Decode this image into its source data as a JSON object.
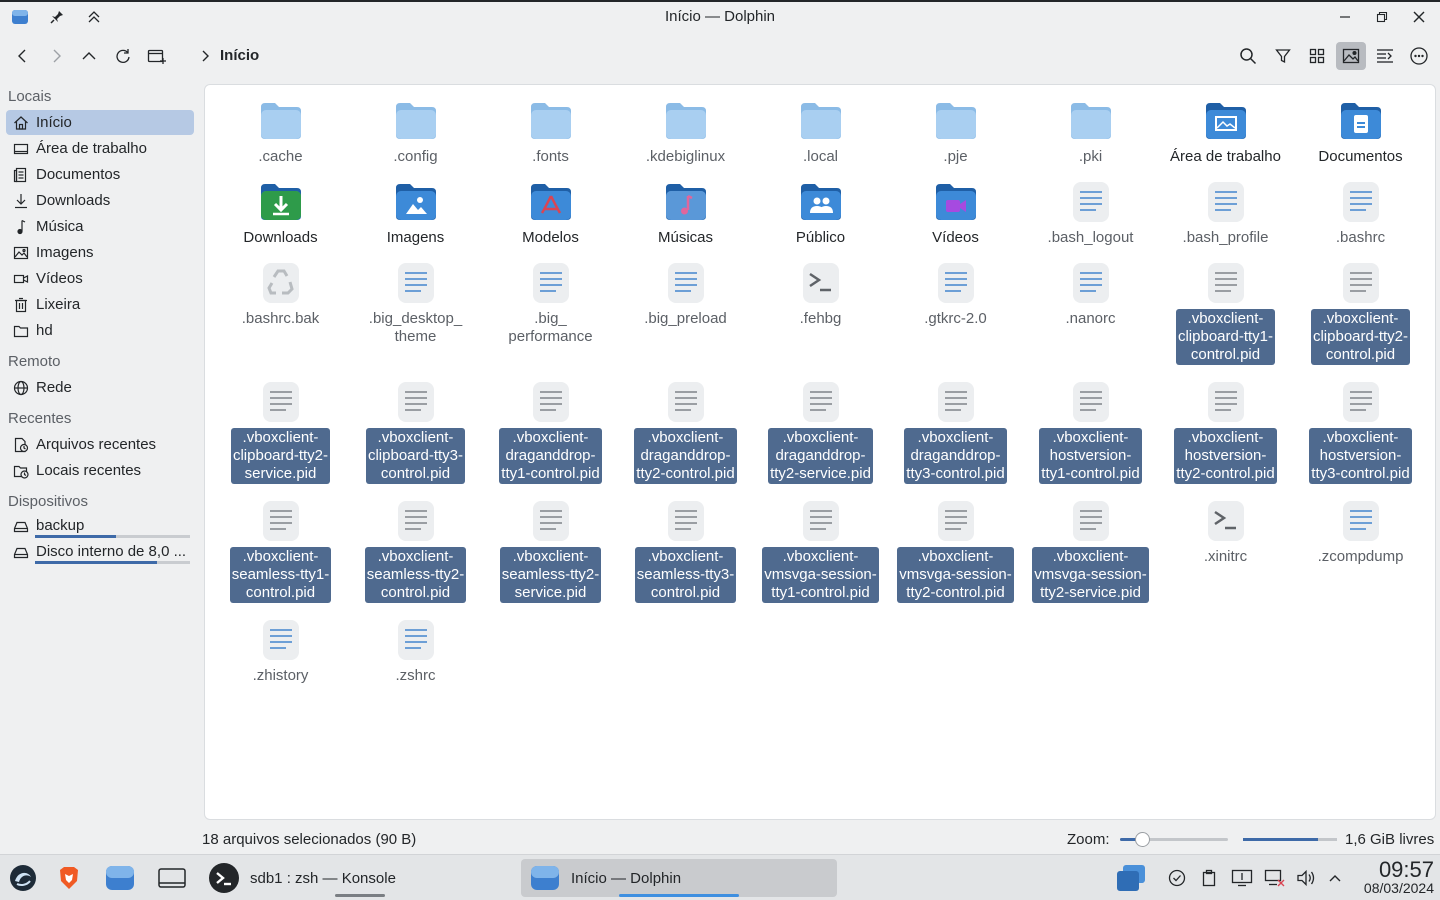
{
  "window": {
    "title": "Início — Dolphin"
  },
  "breadcrumb": {
    "current": "Início"
  },
  "sidebar": {
    "sections": [
      "Locais",
      "Remoto",
      "Recentes",
      "Dispositivos"
    ],
    "places": [
      "Início",
      "Área de trabalho",
      "Documentos",
      "Downloads",
      "Música",
      "Imagens",
      "Vídeos",
      "Lixeira",
      "hd"
    ],
    "remote": [
      "Rede"
    ],
    "recent": [
      "Arquivos recentes",
      "Locais recentes"
    ],
    "devices": [
      {
        "label": "backup",
        "usage": 0.52
      },
      {
        "label": "Disco interno de 8,0 ...",
        "usage": 0.79
      }
    ]
  },
  "files": [
    {
      "name": ".cache",
      "icon": "folder-icon",
      "selected": false
    },
    {
      "name": ".config",
      "icon": "folder-icon",
      "selected": false
    },
    {
      "name": ".fonts",
      "icon": "folder-icon",
      "selected": false
    },
    {
      "name": ".kdebiglinux",
      "icon": "folder-icon",
      "selected": false
    },
    {
      "name": ".local",
      "icon": "folder-icon",
      "selected": false
    },
    {
      "name": ".pje",
      "icon": "folder-icon",
      "selected": false
    },
    {
      "name": ".pki",
      "icon": "folder-icon",
      "selected": false
    },
    {
      "name": "Área de trabalho",
      "icon": "folder-desktop-icon",
      "selected": false
    },
    {
      "name": "Documentos",
      "icon": "folder-documents-icon",
      "selected": false
    },
    {
      "name": "Downloads",
      "icon": "folder-download-icon",
      "selected": false
    },
    {
      "name": "Imagens",
      "icon": "folder-pictures-icon",
      "selected": false
    },
    {
      "name": "Modelos",
      "icon": "folder-templates-icon",
      "selected": false
    },
    {
      "name": "Músicas",
      "icon": "folder-music-icon",
      "selected": false
    },
    {
      "name": "Público",
      "icon": "folder-public-icon",
      "selected": false
    },
    {
      "name": "Vídeos",
      "icon": "folder-videos-icon",
      "selected": false
    },
    {
      "name": ".bash_logout",
      "icon": "text-file-icon",
      "selected": false
    },
    {
      "name": ".bash_profile",
      "icon": "text-file-icon",
      "selected": false
    },
    {
      "name": ".bashrc",
      "icon": "text-file-icon",
      "selected": false
    },
    {
      "name": ".bashrc.bak",
      "icon": "backup-file-icon",
      "selected": false
    },
    {
      "name": ".big_desktop_\ntheme",
      "icon": "text-file-icon",
      "selected": false
    },
    {
      "name": ".big_\nperformance",
      "icon": "text-file-icon",
      "selected": false
    },
    {
      "name": ".big_preload",
      "icon": "text-file-icon",
      "selected": false
    },
    {
      "name": ".fehbg",
      "icon": "script-file-icon",
      "selected": false
    },
    {
      "name": ".gtkrc-2.0",
      "icon": "text-file-icon",
      "selected": false
    },
    {
      "name": ".nanorc",
      "icon": "text-file-icon",
      "selected": false
    },
    {
      "name": ".vboxclient-\nclipboard-tty1-\ncontrol.pid",
      "icon": "plain-file-icon",
      "selected": true
    },
    {
      "name": ".vboxclient-\nclipboard-tty2-\ncontrol.pid",
      "icon": "plain-file-icon",
      "selected": true
    },
    {
      "name": ".vboxclient-\nclipboard-tty2-\nservice.pid",
      "icon": "plain-file-icon",
      "selected": true
    },
    {
      "name": ".vboxclient-\nclipboard-tty3-\ncontrol.pid",
      "icon": "plain-file-icon",
      "selected": true
    },
    {
      "name": ".vboxclient-\ndraganddrop-\ntty1-control.pid",
      "icon": "plain-file-icon",
      "selected": true
    },
    {
      "name": ".vboxclient-\ndraganddrop-\ntty2-control.pid",
      "icon": "plain-file-icon",
      "selected": true
    },
    {
      "name": ".vboxclient-\ndraganddrop-\ntty2-service.pid",
      "icon": "plain-file-icon",
      "selected": true
    },
    {
      "name": ".vboxclient-\ndraganddrop-\ntty3-control.pid",
      "icon": "plain-file-icon",
      "selected": true
    },
    {
      "name": ".vboxclient-\nhostversion-\ntty1-control.pid",
      "icon": "plain-file-icon",
      "selected": true
    },
    {
      "name": ".vboxclient-\nhostversion-\ntty2-control.pid",
      "icon": "plain-file-icon",
      "selected": true
    },
    {
      "name": ".vboxclient-\nhostversion-\ntty3-control.pid",
      "icon": "plain-file-icon",
      "selected": true
    },
    {
      "name": ".vboxclient-\nseamless-tty1-\ncontrol.pid",
      "icon": "plain-file-icon",
      "selected": true
    },
    {
      "name": ".vboxclient-\nseamless-tty2-\ncontrol.pid",
      "icon": "plain-file-icon",
      "selected": true
    },
    {
      "name": ".vboxclient-\nseamless-tty2-\nservice.pid",
      "icon": "plain-file-icon",
      "selected": true
    },
    {
      "name": ".vboxclient-\nseamless-tty3-\ncontrol.pid",
      "icon": "plain-file-icon",
      "selected": true
    },
    {
      "name": ".vboxclient-\nvmsvga-session-\ntty1-control.pid",
      "icon": "plain-file-icon",
      "selected": true
    },
    {
      "name": ".vboxclient-\nvmsvga-session-\ntty2-control.pid",
      "icon": "plain-file-icon",
      "selected": true
    },
    {
      "name": ".vboxclient-\nvmsvga-session-\ntty2-service.pid",
      "icon": "plain-file-icon",
      "selected": true
    },
    {
      "name": ".xinitrc",
      "icon": "script-file-icon",
      "selected": false
    },
    {
      "name": ".zcompdump",
      "icon": "text-file-icon",
      "selected": false
    },
    {
      "name": ".zhistory",
      "icon": "text-file-icon",
      "selected": false
    },
    {
      "name": ".zshrc",
      "icon": "text-file-icon",
      "selected": false
    }
  ],
  "status": {
    "selection": "18 arquivos selecionados (90 B)",
    "zoom_label": "Zoom:",
    "zoom_level": 0.2,
    "free_space": "1,6 GiB livres",
    "free_fraction": 0.8
  },
  "taskbar": {
    "tasks": [
      "sdb1 : zsh — Konsole",
      "Início — Dolphin"
    ],
    "clock_time": "09:57",
    "clock_date": "08/03/2024"
  },
  "colors": {
    "accent": "#3e6aa8",
    "selection": "#4f6a8f",
    "folder": "#a7cdf0"
  }
}
